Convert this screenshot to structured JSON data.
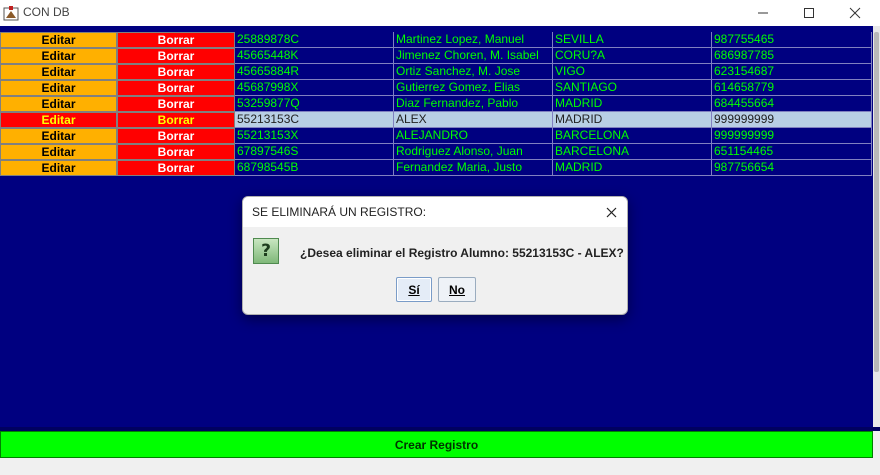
{
  "window": {
    "title": "CON DB",
    "controls": {
      "minimize": "—",
      "maximize": "☐",
      "close": "✕"
    }
  },
  "table": {
    "edit_label": "Editar",
    "delete_label": "Borrar",
    "selected_row_index": 5,
    "rows": [
      {
        "dni": "25889878C",
        "nombre": "Martinez  Lopez, Manuel",
        "ciudad": "SEVILLA",
        "telefono": "987755465"
      },
      {
        "dni": "45665448K",
        "nombre": "Jimenez Choren, M. Isabel",
        "ciudad": "CORU?A",
        "telefono": "686987785"
      },
      {
        "dni": "45665884R",
        "nombre": "Ortiz Sanchez, M. Jose",
        "ciudad": "VIGO",
        "telefono": "623154687"
      },
      {
        "dni": "45687998X",
        "nombre": "Gutierrez Gomez, Elias",
        "ciudad": "SANTIAGO",
        "telefono": "614658779"
      },
      {
        "dni": "53259877Q",
        "nombre": "Diaz Fernandez, Pablo",
        "ciudad": "MADRID",
        "telefono": "684455664"
      },
      {
        "dni": "55213153C",
        "nombre": "ALEX",
        "ciudad": "MADRID",
        "telefono": "999999999"
      },
      {
        "dni": "55213153X",
        "nombre": "ALEJANDRO",
        "ciudad": "BARCELONA",
        "telefono": "999999999"
      },
      {
        "dni": "67897546S",
        "nombre": "Rodriguez Alonso, Juan",
        "ciudad": "BARCELONA",
        "telefono": "651154465"
      },
      {
        "dni": "68798545B",
        "nombre": "Fernandez Maria, Justo",
        "ciudad": "MADRID",
        "telefono": "987756654"
      }
    ]
  },
  "footer": {
    "create_label": "Crear Registro"
  },
  "dialog": {
    "title": "SE ELIMINARÁ UN REGISTRO:",
    "message": "¿Desea eliminar el Registro Alumno: 55213153C - ALEX?",
    "icon": "question-icon",
    "icon_glyph": "?",
    "yes_label": "Sí",
    "no_label": "No"
  },
  "colors": {
    "background": "#000080",
    "edit_button": "#ffb000",
    "delete_button": "#ff0000",
    "data_text": "#00ff00",
    "create_button": "#00ff00",
    "selected_row": "#b8cfe5"
  }
}
